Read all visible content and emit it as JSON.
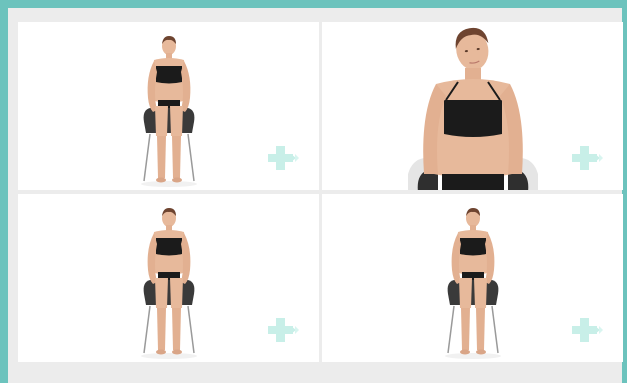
{
  "page": {
    "accent_color": "#6cc3bd",
    "frame_color": "#ececec",
    "plus_color": "#c8efe8"
  },
  "tiles": [
    {
      "pose": "seated-front-full",
      "action_icon": "plus-arrow-icon"
    },
    {
      "pose": "seated-head-tilt-closeup",
      "action_icon": "plus-arrow-icon"
    },
    {
      "pose": "seated-front-full",
      "action_icon": "plus-arrow-icon"
    },
    {
      "pose": "seated-front-full",
      "action_icon": "plus-arrow-icon"
    }
  ]
}
